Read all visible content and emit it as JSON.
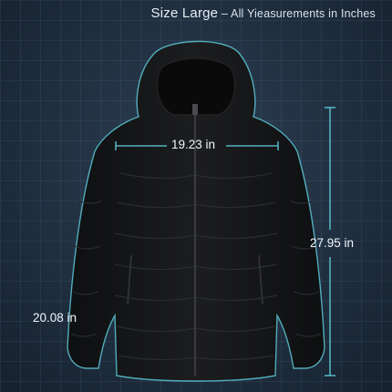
{
  "title": {
    "size": "Size Large",
    "separator": " – ",
    "subtitle": "All Yieasurements in Inches"
  },
  "measurements": {
    "chest": "19.23 in",
    "length": "27.95 in",
    "sleeve": "20.08 in"
  },
  "colors": {
    "background": "#243447",
    "jacket": "#151617",
    "outline": "#5fd0e0",
    "text": "#e6eef6"
  }
}
